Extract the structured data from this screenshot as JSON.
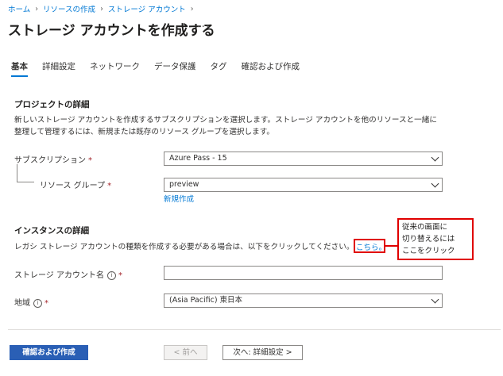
{
  "breadcrumb": [
    "ホーム",
    "リソースの作成",
    "ストレージ アカウント"
  ],
  "page_title": "ストレージ アカウントを作成する",
  "more_label": "···",
  "tabs": [
    {
      "label": "基本"
    },
    {
      "label": "詳細設定"
    },
    {
      "label": "ネットワーク"
    },
    {
      "label": "データ保護"
    },
    {
      "label": "タグ"
    },
    {
      "label": "確認および作成"
    }
  ],
  "project": {
    "heading": "プロジェクトの詳細",
    "description": "新しいストレージ アカウントを作成するサブスクリプションを選択します。ストレージ アカウントを他のリソースと一緒に整理して管理するには、新規または既存のリソース グループを選択します。",
    "subscription_label": "サブスクリプション",
    "subscription_value": "Azure Pass - 15",
    "resource_group_label": "リソース グループ",
    "resource_group_value": "preview",
    "create_new_link": "新規作成"
  },
  "instance": {
    "heading": "インスタンスの詳細",
    "description": "レガシ ストレージ アカウントの種類を作成する必要がある場合は、以下をクリックしてください。",
    "here_link": "こちら。",
    "account_name_label": "ストレージ アカウント名",
    "account_name_value": "",
    "region_label": "地域",
    "region_value": "(Asia Pacific) 東日本"
  },
  "required_mark": "*",
  "info_glyph": "i",
  "callout": {
    "lines": [
      "従来の画面に",
      "切り替えるには",
      "ここをクリック"
    ]
  },
  "footer": {
    "review_button": "確認および作成",
    "prev_button": "< 前へ",
    "next_button": "次へ: 詳細設定 >"
  },
  "colors": {
    "accent": "#0078d4",
    "annotation": "#e00000",
    "primary_button": "#2a5fb5"
  }
}
